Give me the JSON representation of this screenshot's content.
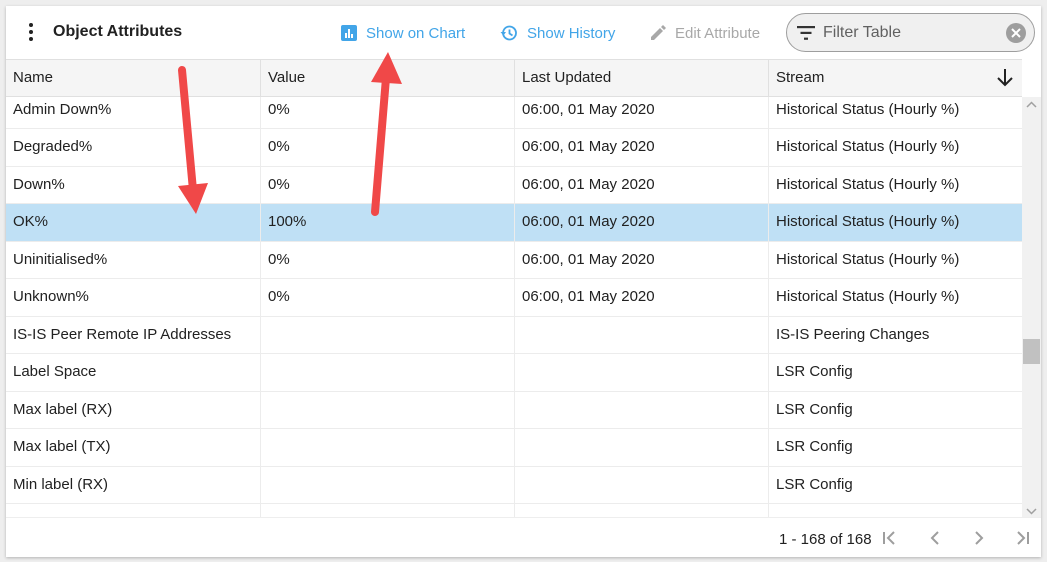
{
  "toolbar": {
    "title": "Object Attributes",
    "show_on_chart": "Show on Chart",
    "show_history": "Show History",
    "edit_attribute": "Edit Attribute",
    "filter_placeholder": "Filter Table",
    "icons": [
      "more-vert-icon",
      "bar-chart-icon",
      "history-icon",
      "edit-icon",
      "filter-icon",
      "clear-icon"
    ]
  },
  "colors": {
    "accent": "#42a5e8",
    "disabled": "#a8a8a8",
    "selected_row": "#bfe0f5",
    "annotation_arrow": "#f04848"
  },
  "table": {
    "columns": [
      "Name",
      "Value",
      "Last Updated",
      "Stream"
    ],
    "sort_column": "Stream",
    "sort_direction": "descending",
    "rows": [
      {
        "name": "Admin Down%",
        "value": "0%",
        "last_updated": "06:00, 01 May 2020",
        "stream": "Historical Status (Hourly %)"
      },
      {
        "name": "Degraded%",
        "value": "0%",
        "last_updated": "06:00, 01 May 2020",
        "stream": "Historical Status (Hourly %)"
      },
      {
        "name": "Down%",
        "value": "0%",
        "last_updated": "06:00, 01 May 2020",
        "stream": "Historical Status (Hourly %)"
      },
      {
        "name": "OK%",
        "value": "100%",
        "last_updated": "06:00, 01 May 2020",
        "stream": "Historical Status (Hourly %)",
        "selected": true
      },
      {
        "name": "Uninitialised%",
        "value": "0%",
        "last_updated": "06:00, 01 May 2020",
        "stream": "Historical Status (Hourly %)"
      },
      {
        "name": "Unknown%",
        "value": "0%",
        "last_updated": "06:00, 01 May 2020",
        "stream": "Historical Status (Hourly %)"
      },
      {
        "name": "IS-IS Peer Remote IP Addresses",
        "value": "",
        "last_updated": "",
        "stream": "IS-IS Peering Changes"
      },
      {
        "name": "Label Space",
        "value": "",
        "last_updated": "",
        "stream": "LSR Config"
      },
      {
        "name": "Max label (RX)",
        "value": "",
        "last_updated": "",
        "stream": "LSR Config"
      },
      {
        "name": "Max label (TX)",
        "value": "",
        "last_updated": "",
        "stream": "LSR Config"
      },
      {
        "name": "Min label (RX)",
        "value": "",
        "last_updated": "",
        "stream": "LSR Config"
      },
      {
        "name": "",
        "value": "",
        "last_updated": "",
        "stream": ""
      }
    ]
  },
  "pagination": {
    "range_text": "1 - 168 of 168",
    "icons": [
      "first-page-icon",
      "prev-page-icon",
      "next-page-icon",
      "last-page-icon"
    ]
  }
}
